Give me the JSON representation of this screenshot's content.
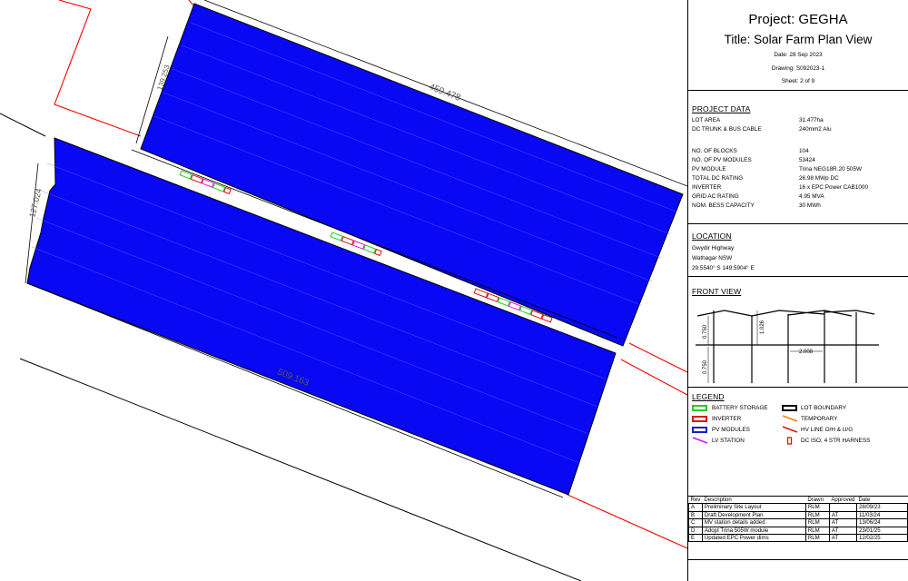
{
  "title_block": {
    "project": "Project: GEGHA",
    "title": "Title: Solar Farm Plan View",
    "date": "Date: 28 Sep 2023",
    "drawing": "Drawing: S092023-1",
    "sheet": "Sheet: 2 of 9"
  },
  "project_data": {
    "heading": "PROJECT DATA",
    "rows": [
      {
        "label": "LOT AREA",
        "value": "31.477ha"
      },
      {
        "label": "DC TRUNK & BUS CABLE",
        "value": "240mm2 Alu"
      },
      {
        "label": "NO. OF BLOCKS",
        "value": "104"
      },
      {
        "label": "NO. OF PV MODULES",
        "value": "53424"
      },
      {
        "label": "PV MODULE",
        "value": "Trina NEG18R.20 505W"
      },
      {
        "label": "TOTAL DC RATING",
        "value": "26.98 MWp DC"
      },
      {
        "label": "INVERTER",
        "value": "16 x EPC Power CAB1000"
      },
      {
        "label": "GRID AC RATING",
        "value": "4.95 MVA"
      },
      {
        "label": "NOM. BESS CAPACITY",
        "value": "30 MWh"
      }
    ]
  },
  "location": {
    "heading": "LOCATION",
    "lines": [
      "Gwydir Highway",
      "Wathagar NSW",
      "29.5540° S  149.5904° E"
    ]
  },
  "front_view": {
    "heading": "FRONT VIEW",
    "dim_height_top": "1.026",
    "dim_height_left": "0.750",
    "dim_height_ground": "0.750",
    "dim_spacing": "2.008"
  },
  "legend": {
    "heading": "LEGEND",
    "items": [
      {
        "label": "BATTERY STORAGE",
        "symbol": "box",
        "color": "#22cc22"
      },
      {
        "label": "LOT BOUNDARY",
        "symbol": "box",
        "color": "#000000"
      },
      {
        "label": "INVERTER",
        "symbol": "box",
        "color": "#e01010"
      },
      {
        "label": "TEMPORARY",
        "symbol": "line",
        "color": "#f08000"
      },
      {
        "label": "PV MODULES",
        "symbol": "box",
        "color": "#1a1acc"
      },
      {
        "label": "HV LINE O/H & U/G",
        "symbol": "line",
        "color": "#e01010"
      },
      {
        "label": "LV STATION",
        "symbol": "line",
        "color": "#e010e0"
      },
      {
        "label": "DC ISO, 4 STR HARNESS",
        "symbol": "iso",
        "color": "#e01010"
      }
    ]
  },
  "revisions": {
    "headers": [
      "Rev",
      "Description",
      "Drawn",
      "Approved",
      "Date"
    ],
    "rows": [
      [
        "A",
        "Preliminary Site Layout",
        "RLM",
        "",
        "28/09/23"
      ],
      [
        "B",
        "Draft Development Plan",
        "RLM",
        "AT",
        "11/03/24"
      ],
      [
        "C",
        "MV station details added",
        "RLM",
        "AT",
        "13/06/24"
      ],
      [
        "D",
        "Adopt Trina 505W module",
        "RLM",
        "AT",
        "23/01/25"
      ],
      [
        "E",
        "Updated EPC Power dims",
        "RLM",
        "AT",
        "12/02/25"
      ]
    ]
  },
  "plan": {
    "dim_north_length": "459.478",
    "dim_south_length": "509.163",
    "dim_west_width": "127.024",
    "dim_north_west": "139.253",
    "colors": {
      "pv": "#0808f5",
      "boundary": "#ff0000",
      "lot": "#000000",
      "battery": "#22cc22",
      "inverter": "#e01010",
      "lv": "#e010e0"
    }
  }
}
